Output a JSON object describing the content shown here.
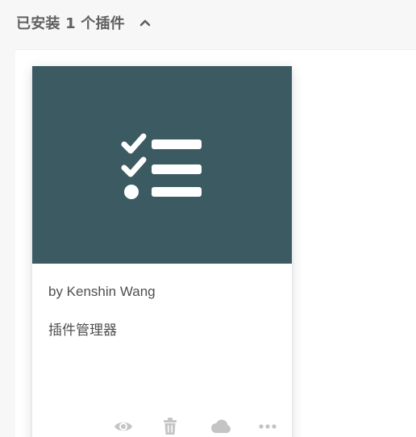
{
  "section": {
    "title": "已安装 1 个插件",
    "toggle_icon": "chevron-up-icon"
  },
  "plugin": {
    "cover_color": "#3b5a62",
    "cover_icon": "checklist-icon",
    "author": "by Kenshin Wang",
    "description": "插件管理器",
    "actions": [
      {
        "name": "preview",
        "icon": "eye-icon"
      },
      {
        "name": "delete",
        "icon": "trash-icon"
      },
      {
        "name": "cloud",
        "icon": "cloud-icon"
      },
      {
        "name": "more",
        "icon": "more-dots-icon"
      }
    ]
  },
  "colors": {
    "page_bg": "#f7f7f7",
    "header_text": "#5f5f5f",
    "action_icon": "#c4c4c4"
  }
}
